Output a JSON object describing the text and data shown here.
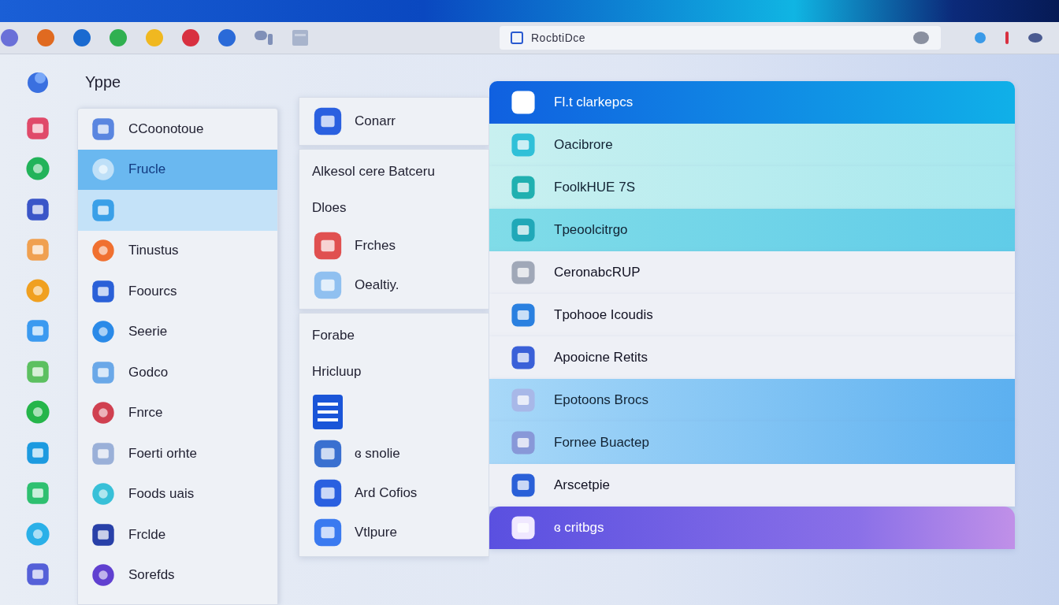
{
  "app": {
    "title": "Yppe"
  },
  "address_bar": {
    "value": "RocbtiDce"
  },
  "sidebar": {
    "items": [
      {
        "label": "CCoonotoue",
        "selected": false,
        "hovered": false
      },
      {
        "label": "Frucle",
        "selected": true,
        "hovered": false
      },
      {
        "selected": false,
        "hovered": true
      },
      {
        "label": "Tinustus",
        "selected": false,
        "hovered": false
      },
      {
        "label": "Foourcs",
        "selected": false,
        "hovered": false
      },
      {
        "label": "Seerie",
        "selected": false,
        "hovered": false
      },
      {
        "label": "Godco",
        "selected": false,
        "hovered": false
      },
      {
        "label": "Fnrce",
        "selected": false,
        "hovered": false
      },
      {
        "label": "Foerti orhte",
        "selected": false,
        "hovered": false
      },
      {
        "label": "Foods uais",
        "selected": false,
        "hovered": false
      },
      {
        "label": "Frclde",
        "selected": false,
        "hovered": false
      },
      {
        "label": "Sorefds",
        "selected": false,
        "hovered": false
      }
    ]
  },
  "middle": {
    "cards": [
      {
        "entries": [
          {
            "kind": "item",
            "label": "Conarr"
          }
        ]
      },
      {
        "entries": [
          {
            "kind": "heading",
            "label": "Alkesol cere Batceru"
          },
          {
            "kind": "heading",
            "label": "Dloes"
          },
          {
            "kind": "item",
            "label": "Frches"
          },
          {
            "kind": "item",
            "label": "Oealtiy."
          }
        ]
      },
      {
        "entries": [
          {
            "kind": "heading",
            "label": "Forabe"
          },
          {
            "kind": "heading",
            "label": "Hricluup"
          },
          {
            "kind": "icon"
          },
          {
            "kind": "item",
            "label": "ɞ snolie"
          },
          {
            "kind": "item",
            "label": "Ard Cofios"
          },
          {
            "kind": "item",
            "label": "Vtlpure"
          }
        ]
      }
    ]
  },
  "stack": {
    "rows": [
      {
        "kind": "header",
        "label": "Fl.t clarkepcs"
      },
      {
        "kind": "teal",
        "label": "Oacibrore"
      },
      {
        "kind": "teal",
        "label": "FoolkHUE 7S"
      },
      {
        "kind": "aqua",
        "label": "Tpeoolcitrgo"
      },
      {
        "kind": "white",
        "label": "CeronabcRUP"
      },
      {
        "kind": "white",
        "label": "Tpohooe Icoudis"
      },
      {
        "kind": "white",
        "label": "Apooicne Retits"
      },
      {
        "kind": "highlight",
        "label": "Epotoons Brocs"
      },
      {
        "kind": "highlight",
        "label": "Fornee Buactep"
      },
      {
        "kind": "white",
        "label": "Arscetpie"
      },
      {
        "kind": "purple",
        "label": "ɞ critbgs"
      }
    ]
  }
}
